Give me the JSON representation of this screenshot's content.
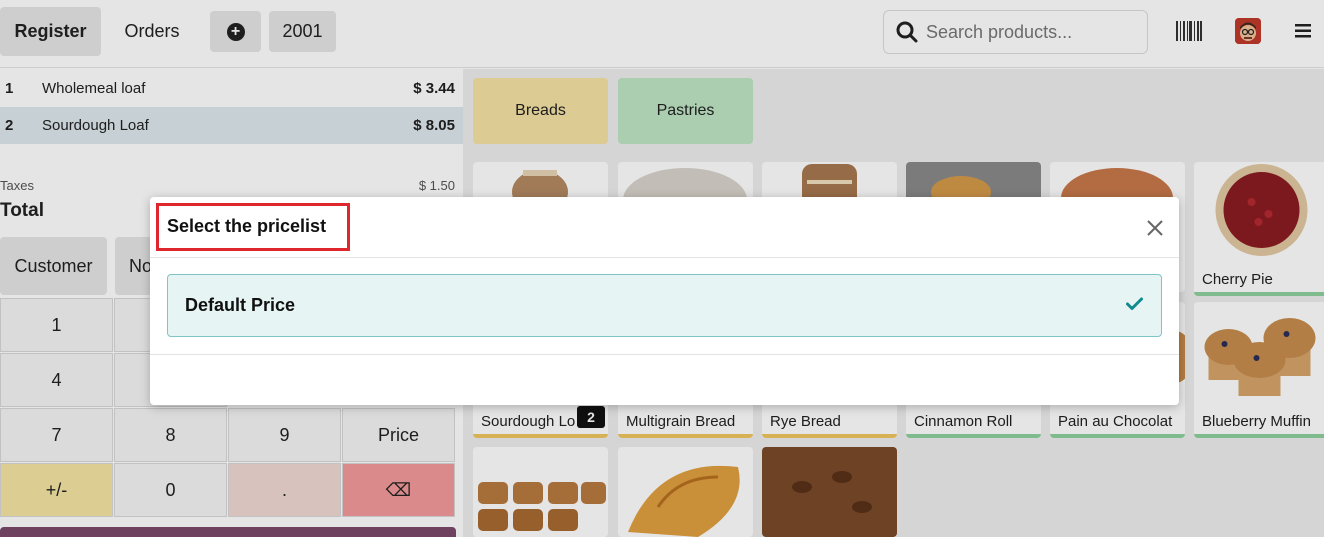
{
  "topbar": {
    "register_label": "Register",
    "orders_label": "Orders",
    "order_number": "2001",
    "search_placeholder": "Search products..."
  },
  "order_lines": [
    {
      "qty": "1",
      "name": "Wholemeal loaf",
      "price": "$ 3.44"
    },
    {
      "qty": "2",
      "name": "Sourdough Loaf",
      "price": "$ 8.05"
    }
  ],
  "summary": {
    "taxes_label": "Taxes",
    "taxes_value": "$ 1.50",
    "total_label": "Total"
  },
  "actions": {
    "customer_label": "Customer",
    "note_label": "No"
  },
  "numpad": [
    "1",
    "4",
    "7",
    "8",
    "9",
    "Price",
    "+/-",
    "0",
    ".",
    "⌫"
  ],
  "categories": [
    {
      "label": "Breads",
      "color": "#f5e2a3"
    },
    {
      "label": "Pastries",
      "color": "#bfe6c4"
    }
  ],
  "products": [
    {
      "name": "Cherry Pie",
      "stripe": "#8fd19e"
    },
    {
      "name": "Sourdough Lo",
      "stripe": "#f0c75e"
    },
    {
      "name": "Multigrain Bread",
      "stripe": "#f0c75e"
    },
    {
      "name": "Rye Bread",
      "stripe": "#f0c75e"
    },
    {
      "name": "Cinnamon Roll",
      "stripe": "#8fd19e"
    },
    {
      "name": "Pain au Chocolat",
      "stripe": "#8fd19e"
    },
    {
      "name": "Blueberry Muffin",
      "stripe": "#8fd19e"
    }
  ],
  "sourdough_badge": "2",
  "modal": {
    "title": "Select the pricelist",
    "option_label": "Default Price"
  },
  "colors": {
    "highlight": "#e0262d",
    "option_bg": "#e6f4f4",
    "check": "#0f8a8f"
  }
}
